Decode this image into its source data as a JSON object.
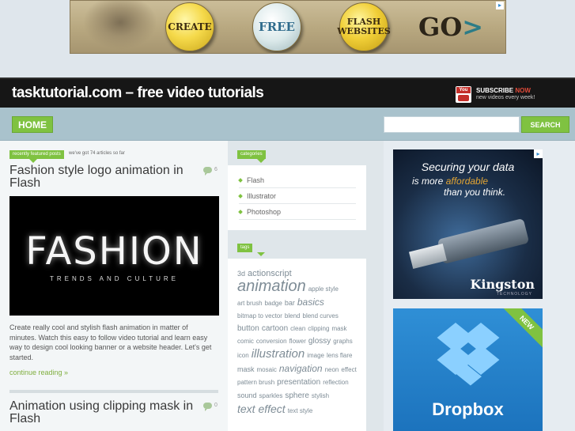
{
  "banner_ad": {
    "pin_create": "CREATE",
    "pin_free": "FREE",
    "pin_flash_line1": "FLASH",
    "pin_flash_line2": "WEBSITES",
    "go_text": "GO",
    "go_arrow": ">"
  },
  "header": {
    "site_title": "tasktutorial.com – free video tutorials",
    "youtube_label": "You Tube",
    "subscribe": "SUBSCRIBE",
    "subscribe_now": "NOW",
    "subscribe_sub": "new videos every week!"
  },
  "nav": {
    "home": "HOME",
    "search_placeholder": "",
    "search_button": "SEARCH"
  },
  "main": {
    "recent_tag": "recently featured posts",
    "count_note": "we've got 74 articles so far",
    "posts": [
      {
        "title": "Fashion style logo animation in Flash",
        "comments": "6",
        "image_title": "FASHION",
        "image_subtitle": "TRENDS AND CULTURE",
        "excerpt": "Create really cool and stylish flash animation in matter of minutes. Watch this easy to follow video tutorial and learn easy way to design cool looking banner or a website header. Let's get started.",
        "continue": "continue reading »"
      },
      {
        "title": "Animation using clipping mask in Flash",
        "comments": "0"
      }
    ]
  },
  "sidebar": {
    "categories_tag": "categories",
    "categories": [
      "Flash",
      "Illustrator",
      "Photoshop"
    ],
    "tags_tag": "tags",
    "tags": [
      {
        "t": "3d",
        "s": 9
      },
      {
        "t": "actionscript",
        "s": 11
      },
      {
        "t": "animation",
        "s": 20
      },
      {
        "t": "apple style",
        "s": 8
      },
      {
        "t": "art brush",
        "s": 8
      },
      {
        "t": "badge",
        "s": 8
      },
      {
        "t": "bar",
        "s": 9
      },
      {
        "t": "basics",
        "s": 12
      },
      {
        "t": "bitmap to vector",
        "s": 8
      },
      {
        "t": "blend",
        "s": 8
      },
      {
        "t": "blend curves",
        "s": 8
      },
      {
        "t": "button",
        "s": 10
      },
      {
        "t": "cartoon",
        "s": 10
      },
      {
        "t": "clean",
        "s": 8
      },
      {
        "t": "clipping",
        "s": 8
      },
      {
        "t": "mask",
        "s": 8
      },
      {
        "t": "comic",
        "s": 8
      },
      {
        "t": "conversion",
        "s": 8
      },
      {
        "t": "flower",
        "s": 8
      },
      {
        "t": "glossy",
        "s": 10
      },
      {
        "t": "graphs",
        "s": 8
      },
      {
        "t": "icon",
        "s": 8
      },
      {
        "t": "illustration",
        "s": 15
      },
      {
        "t": "image",
        "s": 8
      },
      {
        "t": "lens flare",
        "s": 8
      },
      {
        "t": "mask",
        "s": 9
      },
      {
        "t": "mosaic",
        "s": 8
      },
      {
        "t": "navigation",
        "s": 12
      },
      {
        "t": "neon",
        "s": 8
      },
      {
        "t": "effect",
        "s": 8
      },
      {
        "t": "pattern brush",
        "s": 8
      },
      {
        "t": "presentation",
        "s": 10
      },
      {
        "t": "reflection",
        "s": 8
      },
      {
        "t": "sound",
        "s": 9
      },
      {
        "t": "sparkles",
        "s": 8
      },
      {
        "t": "sphere",
        "s": 10
      },
      {
        "t": "stylish",
        "s": 8
      },
      {
        "t": "text effect",
        "s": 14
      },
      {
        "t": "text style",
        "s": 8
      }
    ]
  },
  "ads": {
    "kingston_line1": "Securing your data",
    "kingston_line2a": "is more",
    "kingston_line2b": "affordable",
    "kingston_line3": "than you think.",
    "kingston_brand": "Kingston",
    "kingston_brand_sub": "TECHNOLOGY",
    "dropbox_new": "NEW",
    "dropbox_word": "Dropbox"
  },
  "colors": {
    "accent_green": "#7fc241",
    "header_black": "#161616",
    "nav_blue": "#a9c2cc"
  }
}
